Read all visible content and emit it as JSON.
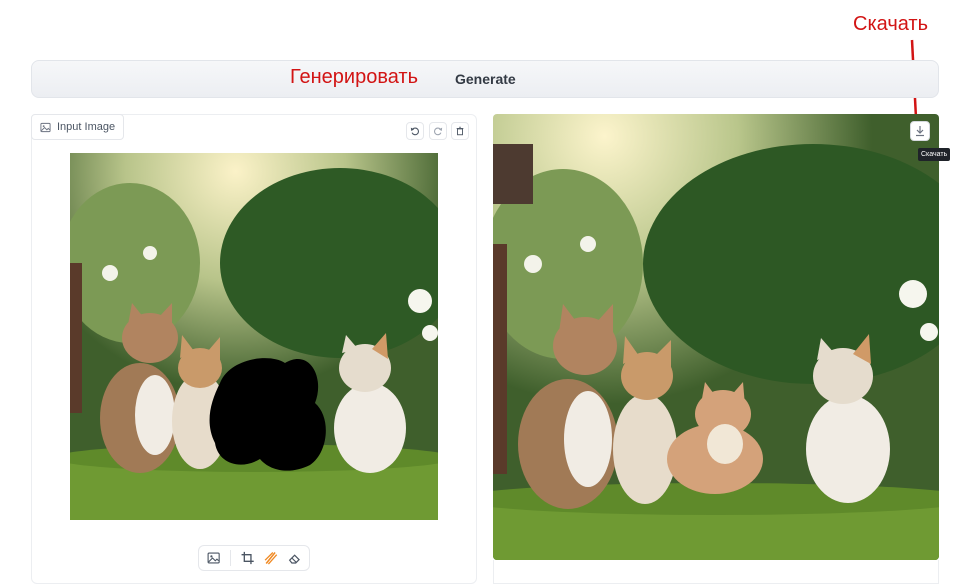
{
  "annotations": {
    "download": "Скачать",
    "generate": "Генерировать"
  },
  "generate_button": {
    "label": "Generate"
  },
  "input_panel": {
    "label": "Input Image",
    "icons": [
      "image-icon",
      "undo-icon",
      "redo-icon",
      "trash-icon"
    ],
    "toolbar_icons": [
      "image-icon",
      "crop-icon",
      "brush-icon",
      "eraser-icon"
    ]
  },
  "output_panel": {
    "download_tooltip": "Скачать",
    "icons": [
      "download-icon"
    ]
  },
  "colors": {
    "annotation_red": "#d21414",
    "brush_accent": "#f08a24"
  }
}
